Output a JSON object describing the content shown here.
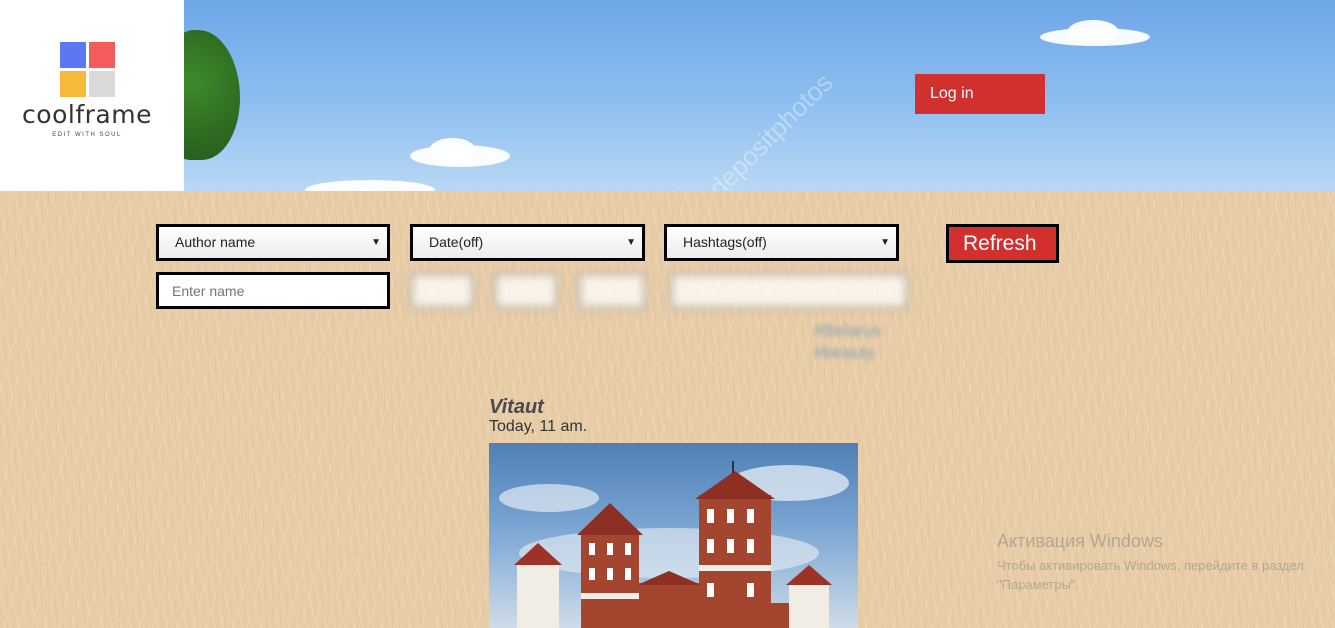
{
  "brand": {
    "name": "coolframe",
    "tagline": "EDIT WITH SOUL",
    "colors": [
      "#5b78f2",
      "#f45b5b",
      "#f7b93a",
      "#d9d9d9"
    ]
  },
  "header": {
    "login_label": "Log in",
    "watermark": "depositphotos"
  },
  "filters": {
    "author_select": "Author name",
    "date_select": "Date(off)",
    "hashtags_select": "Hashtags(off)",
    "refresh_label": "Refresh",
    "name_placeholder": "Enter name",
    "hashtag_list": [
      "#Belarus",
      "#beauty"
    ]
  },
  "post": {
    "author": "Vitaut",
    "time": "Today, 11 am."
  },
  "system": {
    "activation_title": "Активация Windows",
    "activation_text": "Чтобы активировать Windows, перейдите в раздел \"Параметры\"."
  },
  "colors": {
    "accent": "#d22f2f",
    "sky": "#6ea6e8",
    "background": "#e7cca6"
  }
}
